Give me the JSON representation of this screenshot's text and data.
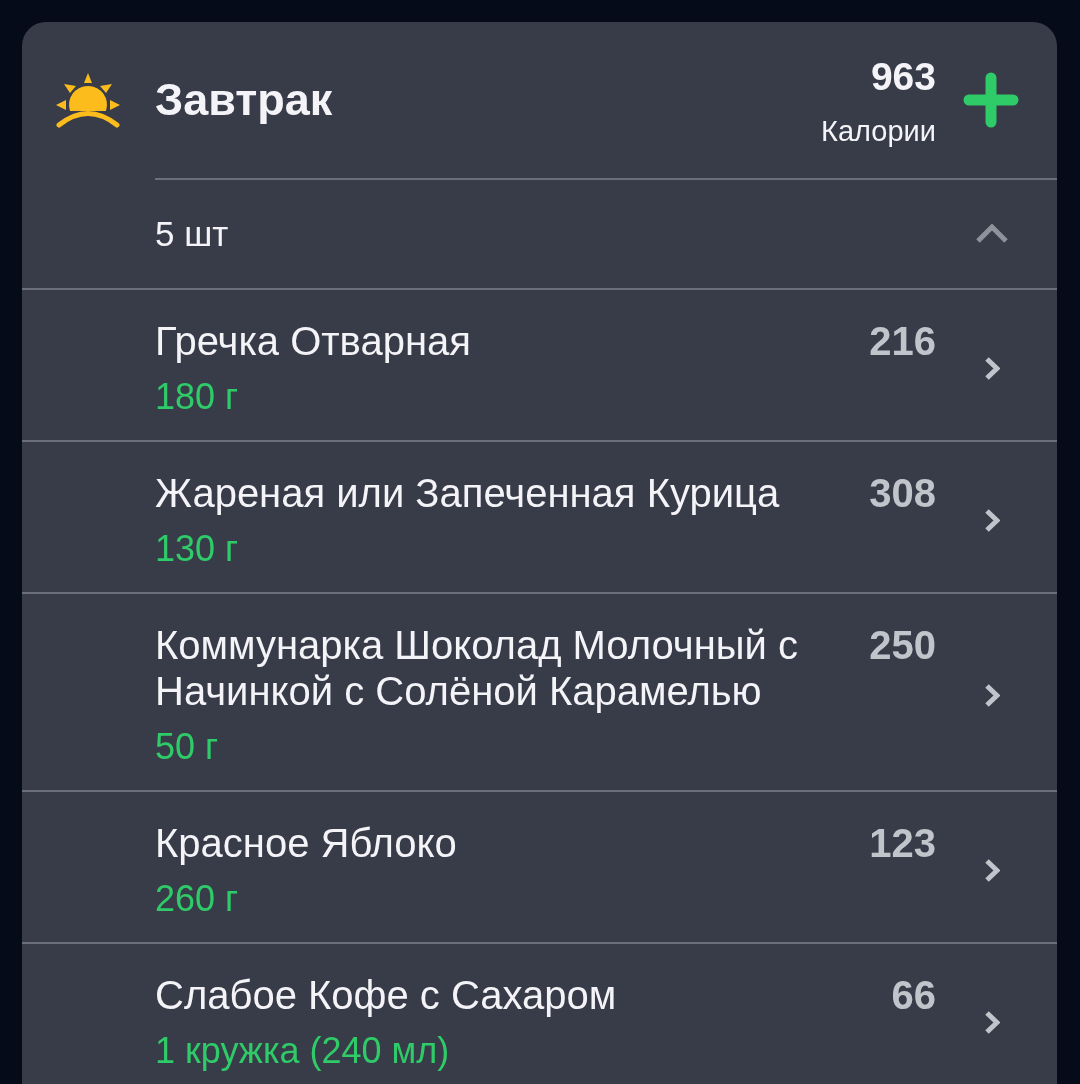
{
  "meal": {
    "title": "Завтрак",
    "calories": "963",
    "calories_label": "Калории"
  },
  "summary": {
    "count": "5 шт",
    "expanded": true
  },
  "items": [
    {
      "name": "Гречка Отварная",
      "amount": "180 г",
      "calories": "216"
    },
    {
      "name": "Жареная или Запеченная Курица",
      "amount": "130 г",
      "calories": "308"
    },
    {
      "name": "Коммунарка Шоколад Молочный с Начинкой с Солёной Карамелью",
      "amount": "50 г",
      "calories": "250"
    },
    {
      "name": "Красное Яблоко",
      "amount": "260 г",
      "calories": "123"
    },
    {
      "name": "Слабое Кофе с Сахаром",
      "amount": "1 кружка (240 мл)",
      "calories": "66"
    }
  ]
}
